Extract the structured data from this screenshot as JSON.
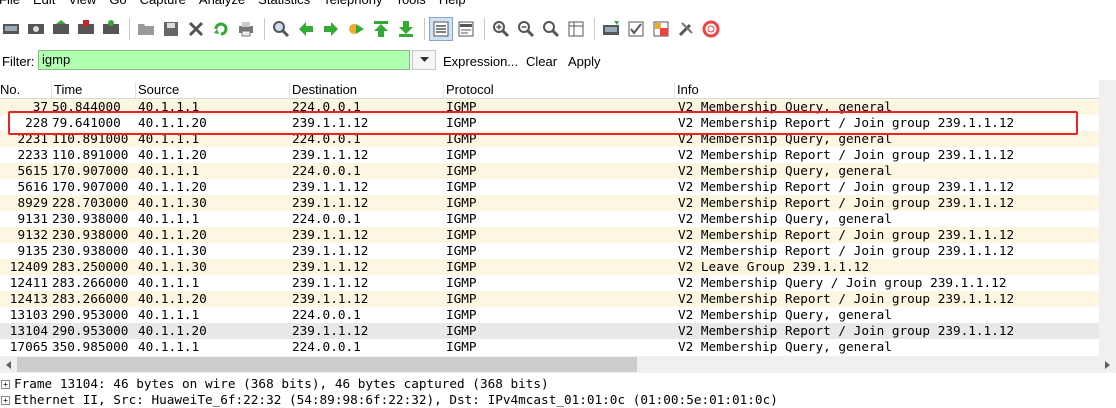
{
  "menu": [
    "File",
    "Edit",
    "View",
    "Go",
    "Capture",
    "Analyze",
    "Statistics",
    "Telephony",
    "Tools",
    "Help"
  ],
  "toolbar_icons": [
    "interface-list-icon",
    "capture-options-icon",
    "start-capture-icon",
    "stop-capture-icon",
    "restart-capture-icon",
    "open-file-icon",
    "save-file-icon",
    "close-file-icon",
    "reload-icon",
    "print-icon",
    "find-packet-icon",
    "go-back-icon",
    "go-forward-icon",
    "go-to-packet-icon",
    "go-first-icon",
    "go-last-icon",
    "colorize-icon",
    "auto-scroll-icon",
    "zoom-in-icon",
    "zoom-out-icon",
    "normal-size-icon",
    "resize-columns-icon",
    "capture-filters-icon",
    "display-filters-icon",
    "coloring-rules-icon",
    "preferences-icon",
    "help-icon"
  ],
  "filter": {
    "label": "Filter:",
    "value": "igmp",
    "expression_label": "Expression...",
    "clear_label": "Clear",
    "apply_label": "Apply"
  },
  "columns": {
    "no": "No.",
    "time": "Time",
    "source": "Source",
    "destination": "Destination",
    "protocol": "Protocol",
    "info": "Info"
  },
  "packets": [
    {
      "no": "37",
      "time": "50.844000",
      "src": "40.1.1.1",
      "dst": "224.0.0.1",
      "proto": "IGMP",
      "info": "V2 Membership Query, general"
    },
    {
      "no": "228",
      "time": "79.641000",
      "src": "40.1.1.20",
      "dst": "239.1.1.12",
      "proto": "IGMP",
      "info": "V2 Membership Report / Join group 239.1.1.12"
    },
    {
      "no": "2231",
      "time": "110.891000",
      "src": "40.1.1.1",
      "dst": "224.0.0.1",
      "proto": "IGMP",
      "info": "V2 Membership Query, general"
    },
    {
      "no": "2233",
      "time": "110.891000",
      "src": "40.1.1.20",
      "dst": "239.1.1.12",
      "proto": "IGMP",
      "info": "V2 Membership Report / Join group 239.1.1.12"
    },
    {
      "no": "5615",
      "time": "170.907000",
      "src": "40.1.1.1",
      "dst": "224.0.0.1",
      "proto": "IGMP",
      "info": "V2 Membership Query, general"
    },
    {
      "no": "5616",
      "time": "170.907000",
      "src": "40.1.1.20",
      "dst": "239.1.1.12",
      "proto": "IGMP",
      "info": "V2 Membership Report / Join group 239.1.1.12"
    },
    {
      "no": "8929",
      "time": "228.703000",
      "src": "40.1.1.30",
      "dst": "239.1.1.12",
      "proto": "IGMP",
      "info": "V2 Membership Report / Join group 239.1.1.12"
    },
    {
      "no": "9131",
      "time": "230.938000",
      "src": "40.1.1.1",
      "dst": "224.0.0.1",
      "proto": "IGMP",
      "info": "V2 Membership Query, general"
    },
    {
      "no": "9132",
      "time": "230.938000",
      "src": "40.1.1.20",
      "dst": "239.1.1.12",
      "proto": "IGMP",
      "info": "V2 Membership Report / Join group 239.1.1.12"
    },
    {
      "no": "9135",
      "time": "230.938000",
      "src": "40.1.1.30",
      "dst": "239.1.1.12",
      "proto": "IGMP",
      "info": "V2 Membership Report / Join group 239.1.1.12"
    },
    {
      "no": "12409",
      "time": "283.250000",
      "src": "40.1.1.30",
      "dst": "239.1.1.12",
      "proto": "IGMP",
      "info": "V2 Leave Group 239.1.1.12"
    },
    {
      "no": "12411",
      "time": "283.266000",
      "src": "40.1.1.1",
      "dst": "239.1.1.12",
      "proto": "IGMP",
      "info": "V2 Membership Query / Join group 239.1.1.12"
    },
    {
      "no": "12413",
      "time": "283.266000",
      "src": "40.1.1.20",
      "dst": "239.1.1.12",
      "proto": "IGMP",
      "info": "V2 Membership Report / Join group 239.1.1.12"
    },
    {
      "no": "13103",
      "time": "290.953000",
      "src": "40.1.1.1",
      "dst": "224.0.0.1",
      "proto": "IGMP",
      "info": "V2 Membership Query, general"
    },
    {
      "no": "13104",
      "time": "290.953000",
      "src": "40.1.1.20",
      "dst": "239.1.1.12",
      "proto": "IGMP",
      "info": "V2 Membership Report / Join group 239.1.1.12"
    },
    {
      "no": "17065",
      "time": "350.985000",
      "src": "40.1.1.1",
      "dst": "224.0.0.1",
      "proto": "IGMP",
      "info": "V2 Membership Query, general"
    }
  ],
  "details": [
    {
      "expander": "+",
      "text": "Frame 13104: 46 bytes on wire (368 bits), 46 bytes captured (368 bits)"
    },
    {
      "expander": "+",
      "text": "Ethernet II, Src: HuaweiTe_6f:22:32 (54:89:98:6f:22:32), Dst: IPv4mcast_01:01:0c (01:00:5e:01:01:0c)"
    }
  ],
  "colors": {
    "row_alt": "#fdf6e0",
    "filter_ok": "#afffaf",
    "highlight_box": "#e8232b"
  }
}
